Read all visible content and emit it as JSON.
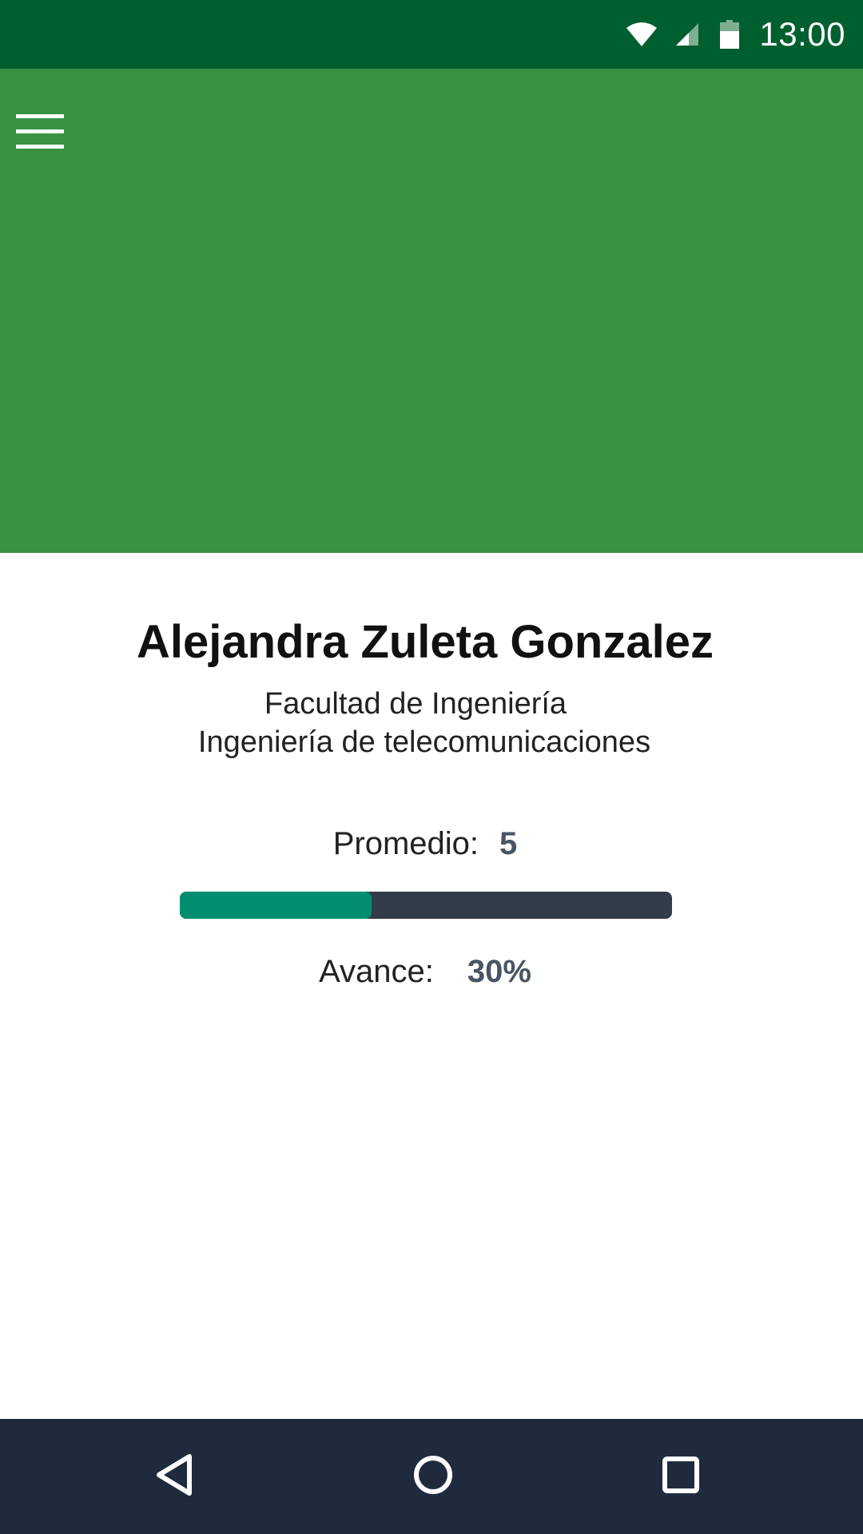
{
  "colors": {
    "status_bar": "#005F2F",
    "app_bar": "#379242",
    "progress_track": "#323C4B",
    "progress_fill": "#018E6E",
    "nav_bar": "#1F2B3D",
    "value_text": "#4A5562"
  },
  "status_bar": {
    "time": "13:00",
    "icons": [
      "wifi-icon",
      "cell-signal-icon",
      "battery-icon"
    ]
  },
  "app_bar": {
    "menu_icon": "hamburger-menu-icon"
  },
  "profile": {
    "name": "Alejandra Zuleta Gonzalez",
    "faculty": "Facultad de Ingeniería",
    "program": "Ingeniería de telecomunicaciones",
    "average_label": "Promedio:",
    "average_value": "5",
    "progress_label": "Avance:",
    "progress_value": "30%",
    "progress_fraction": 0.39
  },
  "nav_bar": {
    "icons": [
      "back-icon",
      "home-icon",
      "recents-icon"
    ]
  }
}
